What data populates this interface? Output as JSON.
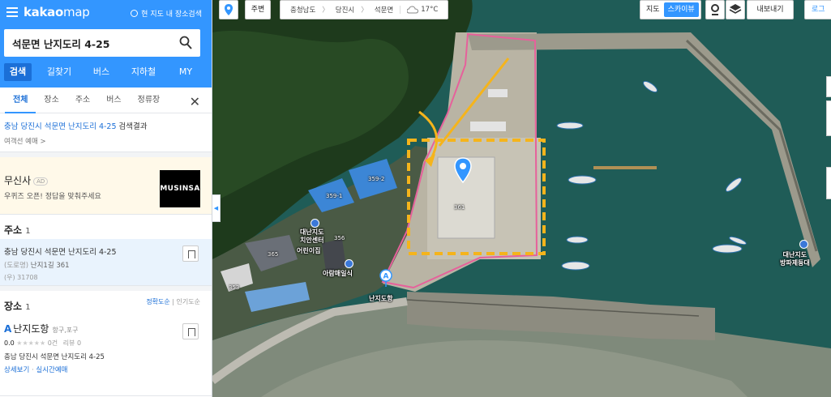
{
  "app": {
    "logo_bold": "kakao",
    "logo_light": "map",
    "view_toggle": "현 지도 내 장소검색"
  },
  "search": {
    "query": "석문면 난지도리 4-25"
  },
  "mode_tabs": [
    "검색",
    "길찾기",
    "버스",
    "지하철",
    "MY"
  ],
  "category_tabs": [
    "전체",
    "장소",
    "주소",
    "버스",
    "정류장"
  ],
  "result_header": {
    "query_prefix": "충남 당진시 석문면 난지도리 4-25",
    "query_suffix": " 검색결과",
    "suggestion": "여객선 예매 >"
  },
  "ad": {
    "name": "무신사",
    "tag": "AD",
    "description": "우퀴즈 오픈! 정답을 맞춰주세요",
    "brand_logo": "MUSINSA"
  },
  "address_section": {
    "title": "주소",
    "count": "1",
    "item": {
      "main": "충남 당진시 석문면 난지도리 4-25",
      "road_label": "(도로명)",
      "road": " 난지1길 361",
      "zip": "(우) 31708"
    }
  },
  "place_section": {
    "title": "장소",
    "count": "1",
    "sort_on": "정확도순",
    "sort_sep": " | ",
    "sort_off": "인기도순",
    "item": {
      "marker": "A",
      "name": "난지도항",
      "category": "항구,포구",
      "score": "0.0",
      "stars": "★★★★★",
      "review_count": "0건",
      "reviews": "리뷰 0",
      "address": "충남 당진시 석문면 난지도리 4-25",
      "link_detail": "상세보기",
      "link_sep": " · ",
      "link_live": "실시간예매"
    }
  },
  "map_top": {
    "near": "주변",
    "crumbs": [
      "충청남도",
      "당진시",
      "석문면"
    ],
    "temperature": "17°C",
    "map_types": [
      "지도",
      "스카이뷰"
    ],
    "share": "내보내기",
    "login": "로그"
  },
  "map_labels": {
    "lots": [
      "359-2",
      "359-1",
      "361",
      "356",
      "365",
      "353"
    ],
    "pois": [
      "대난지도\n치안센터",
      "어린이집",
      "아람매일식",
      "난지도항",
      "대난지도\n방파제등대"
    ]
  },
  "colors": {
    "brand_blue": "#3396ff",
    "highlight_orange": "#f5b41b",
    "boundary_pink": "#e6619b",
    "sea": "#1d5a55"
  }
}
